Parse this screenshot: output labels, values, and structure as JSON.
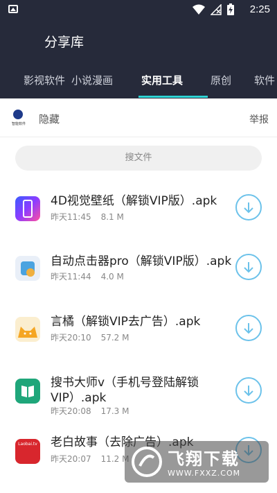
{
  "status_bar": {
    "time": "2:25"
  },
  "header": {
    "title": "分享库"
  },
  "tabs": [
    {
      "label": "影视软件"
    },
    {
      "label": "小说漫画"
    },
    {
      "label": "实用工具"
    },
    {
      "label": "原创"
    },
    {
      "label": "软件"
    }
  ],
  "channel": {
    "hide_label": "隐藏",
    "report_label": "举报",
    "logo_text": "智能软件"
  },
  "search": {
    "placeholder": "搜文件"
  },
  "files": [
    {
      "name": "4D视觉壁纸（解锁VIP版）.apk",
      "date": "昨天11:45",
      "size": "8.1 M"
    },
    {
      "name": "自动点击器pro（解锁VIP版）.apk",
      "date": "昨天11:44",
      "size": "4.0 M"
    },
    {
      "name": "言橘（解锁VIP去广告）.apk",
      "date": "昨天20:10",
      "size": "57.2 M"
    },
    {
      "name": "搜书大师v（手机号登陆解锁VIP）.apk",
      "date": "昨天20:08",
      "size": "17.3 M"
    },
    {
      "name": "老白故事（去除广告）.apk",
      "date": "昨天20:07",
      "size": "11.2 M",
      "icon_text": "Laobai.tv"
    }
  ],
  "watermark": {
    "title": "飞翔下载",
    "url": "WWW.FXXZ.COM"
  },
  "colors": {
    "header_bg": "#262a3a",
    "accent": "#2fd5d5",
    "download": "#6cc2ea"
  }
}
